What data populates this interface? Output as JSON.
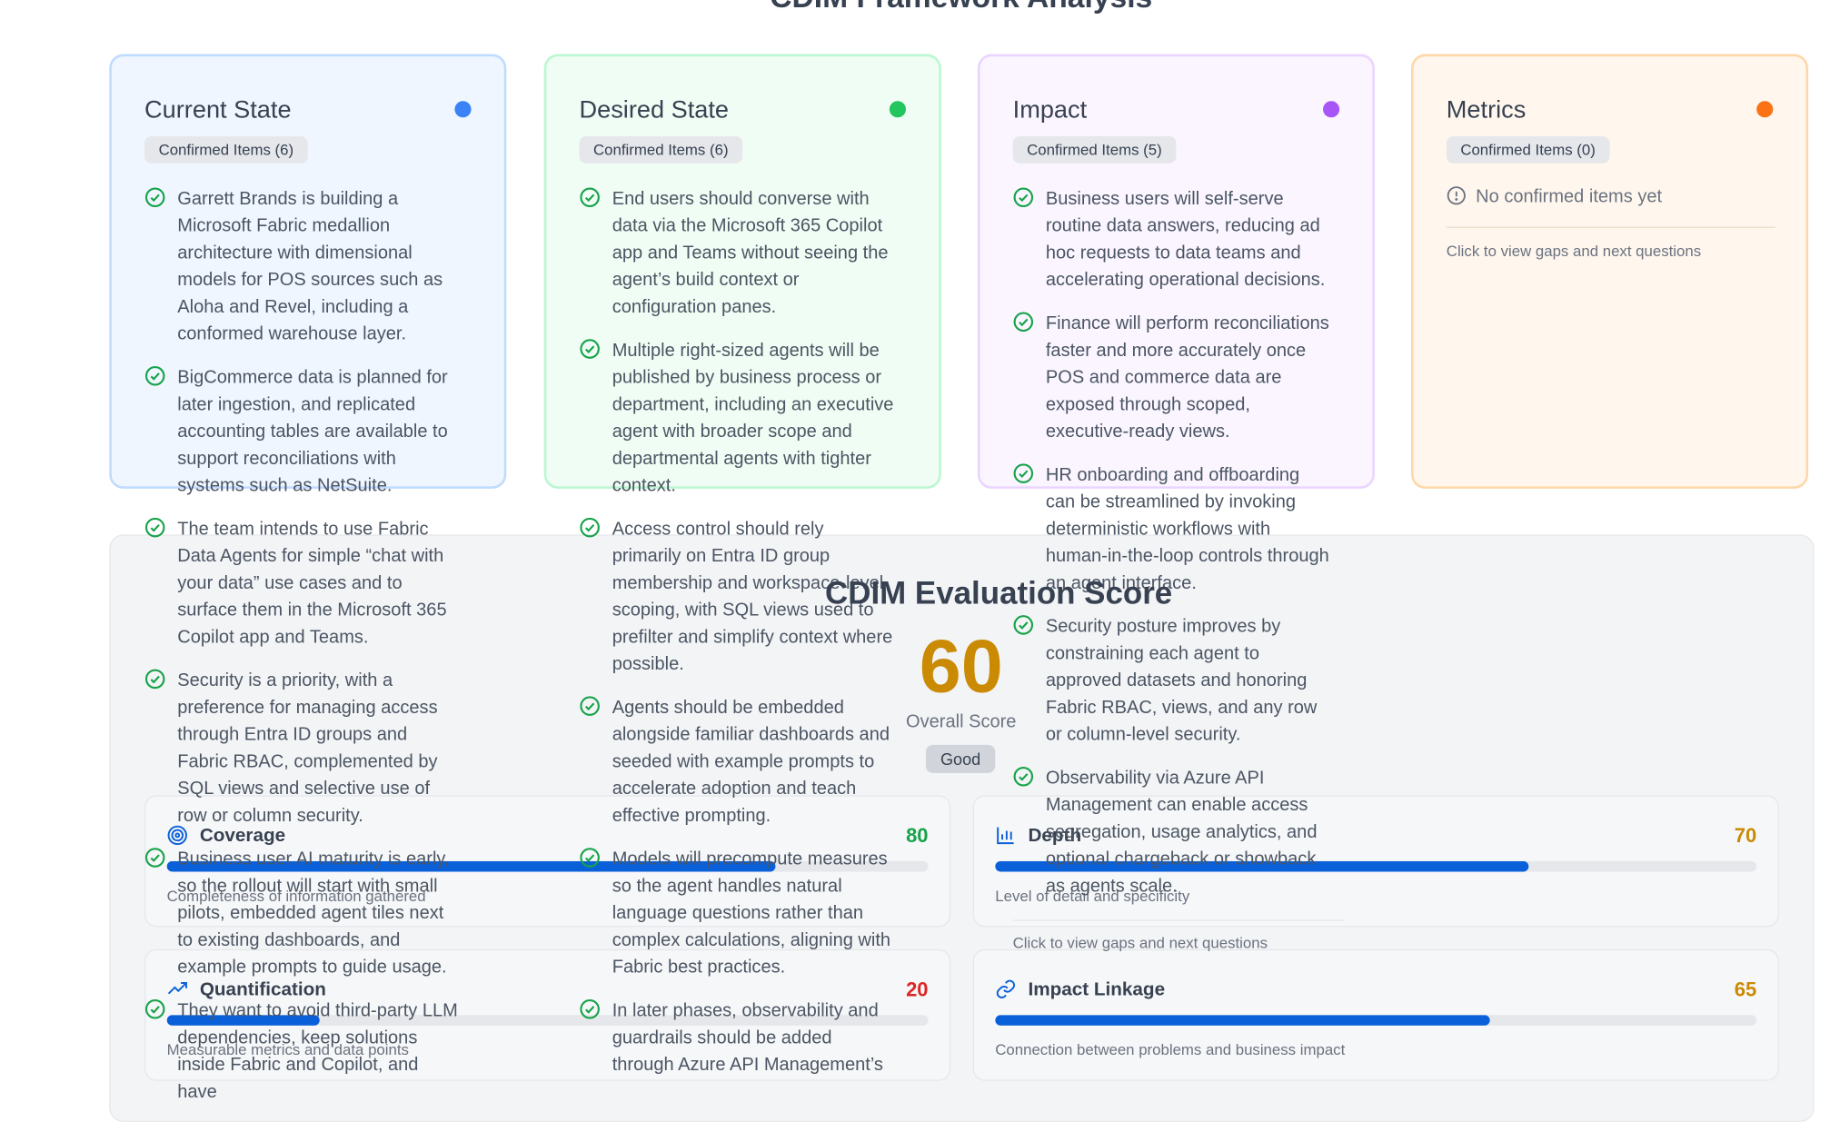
{
  "page": {
    "title": "CDIM Framework Analysis"
  },
  "cards": [
    {
      "title": "Current State",
      "dot_color": "#3b82f6",
      "bg": "#eff6ff",
      "border": "#bfdbfe",
      "chip": "Confirmed Items (6)",
      "items": [
        "Garrett Brands is building a Microsoft Fabric medallion architecture with dimensional models for POS sources such as Aloha and Revel, including a conformed warehouse layer.",
        "BigCommerce data is planned for later ingestion, and replicated accounting tables are available to support reconciliations with systems such as NetSuite.",
        "The team intends to use Fabric Data Agents for simple “chat with your data” use cases and to surface them in the Microsoft 365 Copilot app and Teams.",
        "Security is a priority, with a preference for managing access through Entra ID groups and Fabric RBAC, complemented by SQL views and selective use of row or column security.",
        "Business user AI maturity is early, so the rollout will start with small pilots, embedded agent tiles next to existing dashboards, and example prompts to guide usage.",
        "They want to avoid third-party LLM dependencies, keep solutions inside Fabric and Copilot, and have"
      ]
    },
    {
      "title": "Desired State",
      "dot_color": "#22c55e",
      "bg": "#f0fdf4",
      "border": "#bbf7d0",
      "chip": "Confirmed Items (6)",
      "items": [
        "End users should converse with data via the Microsoft 365 Copilot app and Teams without seeing the agent’s build context or configuration panes.",
        "Multiple right-sized agents will be published by business process or department, including an executive agent with broader scope and departmental agents with tighter context.",
        "Access control should rely primarily on Entra ID group membership and workspace-level scoping, with SQL views used to prefilter and simplify context where possible.",
        "Agents should be embedded alongside familiar dashboards and seeded with example prompts to accelerate adoption and teach effective prompting.",
        "Models will precompute measures so the agent handles natural language questions rather than complex calculations, aligning with Fabric best practices.",
        "In later phases, observability and guardrails should be added through Azure API Management’s"
      ]
    },
    {
      "title": "Impact",
      "dot_color": "#a855f7",
      "bg": "#faf5ff",
      "border": "#e9d5ff",
      "chip": "Confirmed Items (5)",
      "items": [
        "Business users will self-serve routine data answers, reducing ad hoc requests to data teams and accelerating operational decisions.",
        "Finance will perform reconciliations faster and more accurately once POS and commerce data are exposed through scoped, executive-ready views.",
        "HR onboarding and offboarding can be streamlined by invoking deterministic workflows with human-in-the-loop controls through an agent interface.",
        "Security posture improves by constraining each agent to approved datasets and honoring Fabric RBAC, views, and any row or column-level security.",
        "Observability via Azure API Management can enable access segregation, usage analytics, and optional chargeback or showback as agents scale."
      ],
      "footer": "Click to view gaps and next questions"
    },
    {
      "title": "Metrics",
      "dot_color": "#f97316",
      "bg": "#fff7ed",
      "border": "#fed7aa",
      "chip": "Confirmed Items (0)",
      "empty_text": "No confirmed items yet",
      "footer": "Click to view gaps and next questions"
    }
  ],
  "evaluation": {
    "title": "CDIM Evaluation Score",
    "score": "60",
    "score_label": "Overall Score",
    "rating": "Good",
    "metrics": [
      {
        "name": "Coverage",
        "score": "80",
        "value": 80,
        "color": "#16a34a",
        "icon": "target-icon",
        "desc": "Completeness of information gathered"
      },
      {
        "name": "Depth",
        "score": "70",
        "value": 70,
        "color": "#ca8a04",
        "icon": "bar-chart-icon",
        "desc": "Level of detail and specificity"
      },
      {
        "name": "Quantification",
        "score": "20",
        "value": 20,
        "color": "#dc2626",
        "icon": "trending-up-icon",
        "desc": "Measurable metrics and data points"
      },
      {
        "name": "Impact Linkage",
        "score": "65",
        "value": 65,
        "color": "#ca8a04",
        "icon": "link-icon",
        "desc": "Connection between problems and business impact"
      }
    ]
  },
  "colors": {
    "check": "#16a34a",
    "bar_fill": "#0a60d9",
    "panel_bg": "#f3f4f6"
  }
}
